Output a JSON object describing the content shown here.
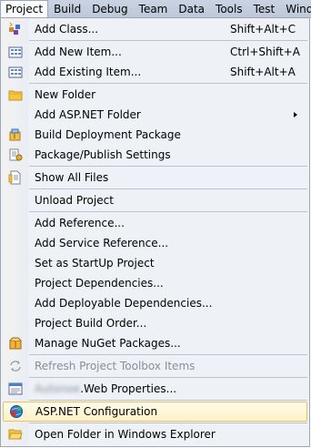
{
  "menubar": {
    "items": [
      "Project",
      "Build",
      "Debug",
      "Team",
      "Data",
      "Tools",
      "Test",
      "Window"
    ]
  },
  "menu": {
    "add_class": {
      "label": "Add Class...",
      "shortcut": "Shift+Alt+C"
    },
    "add_new_item": {
      "label": "Add New Item...",
      "shortcut": "Ctrl+Shift+A"
    },
    "add_existing_item": {
      "label": "Add Existing Item...",
      "shortcut": "Shift+Alt+A"
    },
    "new_folder": {
      "label": "New Folder"
    },
    "add_aspnet_folder": {
      "label": "Add ASP.NET Folder"
    },
    "build_deployment_package": {
      "label": "Build Deployment Package"
    },
    "package_publish_settings": {
      "label": "Package/Publish Settings"
    },
    "show_all_files": {
      "label": "Show All Files"
    },
    "unload_project": {
      "label": "Unload Project"
    },
    "add_reference": {
      "label": "Add Reference..."
    },
    "add_service_reference": {
      "label": "Add Service Reference..."
    },
    "set_startup_project": {
      "label": "Set as StartUp Project"
    },
    "project_dependencies": {
      "label": "Project Dependencies..."
    },
    "add_deployable_dependencies": {
      "label": "Add Deployable Dependencies..."
    },
    "project_build_order": {
      "label": "Project Build Order..."
    },
    "manage_nuget_packages": {
      "label": "Manage NuGet Packages..."
    },
    "refresh_toolbox": {
      "label": "Refresh Project Toolbox Items"
    },
    "web_properties": {
      "blurred_name": "Autonoe",
      "label": ".Web Properties..."
    },
    "aspnet_configuration": {
      "label": "ASP.NET Configuration"
    },
    "open_folder_explorer": {
      "label": "Open Folder in Windows Explorer"
    }
  },
  "colors": {
    "menubar": "#c4cedd",
    "menu_background": "#eef1f6",
    "highlight_fill": "#fff1c7",
    "highlight_border": "#e5c365",
    "disabled_text": "#8a8e96"
  }
}
